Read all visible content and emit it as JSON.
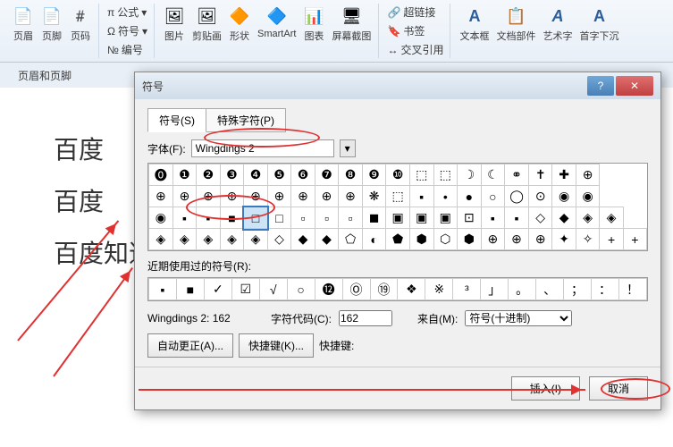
{
  "ribbon": {
    "group1": {
      "items": [
        "页眉",
        "页脚",
        "页码"
      ],
      "label": "页眉和页脚"
    },
    "group2": {
      "small": [
        "公式",
        "符号",
        "编号"
      ],
      "items": [
        "图片",
        "剪贴画",
        "形状",
        "SmartArt",
        "图表",
        "屏幕截图"
      ]
    },
    "group3": {
      "small": [
        "超链接",
        "书签",
        "交叉引用"
      ]
    },
    "group4": {
      "items": [
        "文本框",
        "文档部件",
        "艺术字",
        "首字下沉"
      ]
    }
  },
  "doc": {
    "lines": [
      "百度",
      "百度",
      "百度知道"
    ]
  },
  "dialog": {
    "title": "符号",
    "tabs": [
      "符号(S)",
      "特殊字符(P)"
    ],
    "font_label": "字体(F):",
    "font_value": "Wingdings 2",
    "grid": [
      [
        "⓿",
        "❶",
        "❷",
        "❸",
        "❹",
        "❺",
        "❻",
        "❼",
        "❽",
        "❾",
        "❿",
        "⬚",
        "⬚",
        "☽",
        "☾",
        "⚭",
        "✝",
        "✚",
        "⊕"
      ],
      [
        "⊕",
        "⊕",
        "⊕",
        "⊕",
        "⊕",
        "⊕",
        "⊕",
        "⊕",
        "⊕",
        "❋",
        "⬚",
        "▪",
        "•",
        "●",
        "○",
        "◯",
        "⊙",
        "◉",
        "◉"
      ],
      [
        "◉",
        "▪",
        "▪",
        "■",
        "□",
        "□",
        "▫",
        "▫",
        "▫",
        "◼",
        "▣",
        "▣",
        "▣",
        "⊡",
        "▪",
        "▪",
        "◇",
        "◆",
        "◈",
        "◈"
      ],
      [
        "◈",
        "◈",
        "◈",
        "◈",
        "◈",
        "◇",
        "◆",
        "◆",
        "⬠",
        "◐",
        "⬟",
        "⬢",
        "⬡",
        "⬢",
        "⊕",
        "⊕",
        "⊕",
        "✦",
        "✧",
        "+",
        "+"
      ]
    ],
    "recent_label": "近期使用过的符号(R):",
    "recent": [
      "▪",
      "■",
      "✓",
      "☑",
      "√",
      "○",
      "⓬",
      "Ⓞ",
      "⑲",
      "❖",
      "※",
      "³",
      "」",
      "。",
      "、",
      "；",
      "：",
      "！"
    ],
    "code_name": "Wingdings 2: 162",
    "code_label": "字符代码(C):",
    "code_value": "162",
    "from_label": "来自(M):",
    "from_value": "符号(十进制)",
    "autocorrect": "自动更正(A)...",
    "shortcut": "快捷键(K)...",
    "shortcut_label": "快捷键:",
    "insert": "插入(I)",
    "cancel": "取消"
  }
}
